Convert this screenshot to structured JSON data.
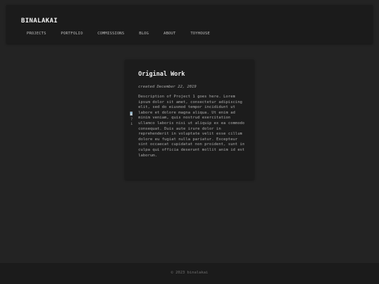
{
  "header": {
    "site_title": "BINALAKAI",
    "nav": [
      "PROJECTS",
      "PORTFOLIO",
      "COMMISSIONS",
      "BLOG",
      "ABOUT",
      "TOYHOUSE"
    ]
  },
  "card": {
    "title": "Original Work",
    "date": "created December 22, 2019",
    "thumbnail_glyph": "?",
    "body": "Description of Project 1 goes here. Lorem ipsum dolor sit amet, consectetur adipiscing elit, sed do eiusmod tempor incididunt ut labore et dolore magna aliqua. Ut enim ad minim veniam, quis nostrud exercitation ullamco laboris nisi ut aliquip ex ea commodo consequat. Duis aute irure dolor in reprehenderit in voluptate velit esse cillum dolore eu fugiat nulla pariatur. Excepteur sint occaecat cupidatat non proident, sunt in culpa qui officia deserunt mollit anim id est laborum."
  },
  "footer": {
    "text": "© 2023 binalakai"
  },
  "colors": {
    "background": "#232323",
    "panel": "#1b1b1b",
    "title_text": "#f2f2f2",
    "muted_text": "#a9a9a9"
  }
}
